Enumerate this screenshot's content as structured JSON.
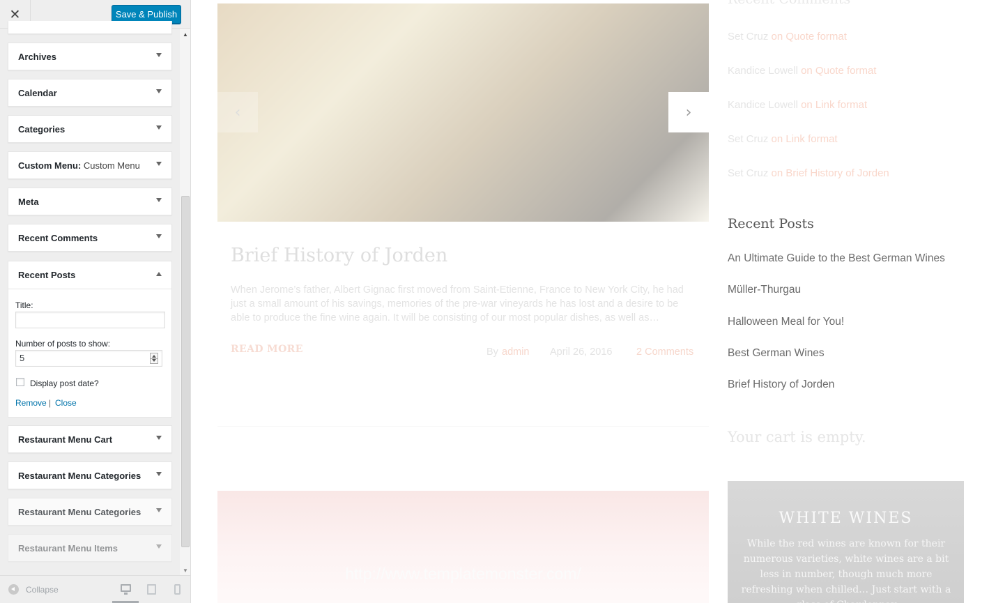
{
  "topbar": {
    "close_glyph": "✕",
    "publish_label": "Save & Publish"
  },
  "widgets": {
    "archives": "Archives",
    "calendar": "Calendar",
    "categories": "Categories",
    "custom_menu": "Custom Menu:",
    "custom_menu_instance": "Custom Menu",
    "meta": "Meta",
    "recent_comments": "Recent Comments",
    "recent_posts": "Recent Posts",
    "restaurant_cart": "Restaurant Menu Cart",
    "restaurant_categories_1": "Restaurant Menu Categories",
    "restaurant_categories_2": "Restaurant Menu Categories",
    "restaurant_items": "Restaurant Menu Items"
  },
  "recent_posts_form": {
    "title_label": "Title:",
    "title_value": "",
    "count_label": "Number of posts to show:",
    "count_value": "5",
    "date_label": "Display post date?",
    "date_checked": false,
    "remove_label": "Remove",
    "separator": "|",
    "close_label": "Close"
  },
  "footer": {
    "collapse_label": "Collapse",
    "active_device": "desktop"
  },
  "preview": {
    "slider": {
      "prev_glyph": "‹",
      "next_glyph": "›"
    },
    "post": {
      "title": "Brief History of Jorden",
      "excerpt": "When Jerome’s father, Albert Gignac first moved from Saint-Etienne, France to New York City, he had just a small amount of his savings, memories of the pre-war vineyards he has lost and a desire to be able to produce the fine wine again. It will be consisting of our most popular dishes, as well as…",
      "read_more": "READ MORE",
      "by": "By",
      "author": "admin",
      "date": "April 26, 2016",
      "comments": "2 Comments"
    },
    "link_post": {
      "url": "http://www.templatemonster.com/"
    },
    "recent_comments": {
      "heading": "Recent Comments",
      "items": [
        {
          "author": "Set Cruz",
          "on": "on Quote format"
        },
        {
          "author": "Kandice Lowell",
          "on": "on Quote format"
        },
        {
          "author": "Kandice Lowell",
          "on": "on Link format"
        },
        {
          "author": "Set Cruz",
          "on": "on Link format"
        },
        {
          "author": "Set Cruz",
          "on": "on Brief History of Jorden"
        }
      ]
    },
    "recent_posts": {
      "heading": "Recent Posts",
      "items": [
        "An Ultimate Guide to the Best German Wines",
        "Müller-Thurgau",
        "Halloween Meal for You!",
        "Best German Wines",
        "Brief History of Jorden"
      ]
    },
    "cart": {
      "empty": "Your cart is empty."
    },
    "white_wines": {
      "title": "WHITE WINES",
      "text": "While the red wines are known for their nu­merous varieties, white wines are a bit less in number, though much more refreshing when chilled… Just start with a glass of Chardonnay"
    }
  }
}
